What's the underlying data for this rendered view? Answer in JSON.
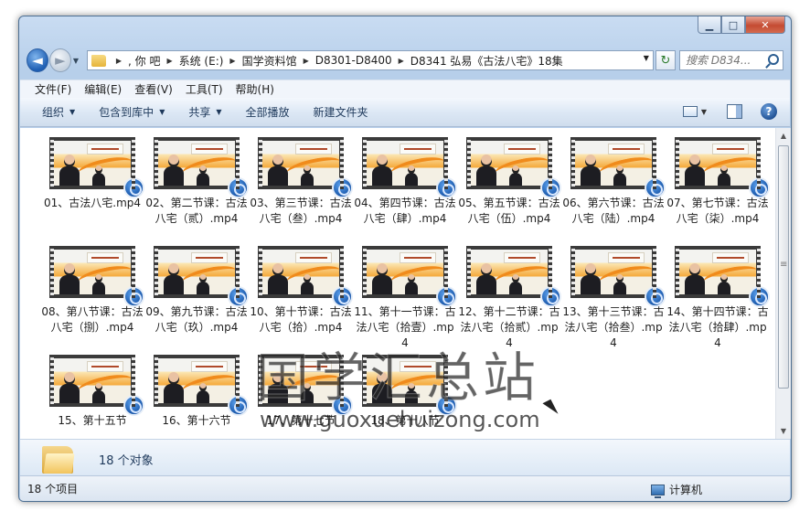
{
  "address_bar": {
    "crumbs": [
      ", 你    吧",
      "系统 (E:)",
      "国学资料馆",
      "D8301-D8400",
      "D8341 弘易《古法八宅》18集"
    ],
    "search_placeholder": "搜索 D834..."
  },
  "menu": [
    "文件(F)",
    "编辑(E)",
    "查看(V)",
    "工具(T)",
    "帮助(H)"
  ],
  "toolbar": {
    "organize": "组织",
    "include_library": "包含到库中",
    "share": "共享",
    "play_all": "全部播放",
    "new_folder": "新建文件夹"
  },
  "files": [
    "01、古法八宅.mp4",
    "02、第二节课：古法八宅（贰）.mp4",
    "03、第三节课：古法八宅（叁）.mp4",
    "04、第四节课：古法八宅（肆）.mp4",
    "05、第五节课：古法八宅（伍）.mp4",
    "06、第六节课：古法八宅（陆）.mp4",
    "07、第七节课：古法八宅（柒）.mp4",
    "08、第八节课：古法八宅（捌）.mp4",
    "09、第九节课：古法八宅（玖）.mp4",
    "10、第十节课：古法八宅（拾）.mp4",
    "11、第十一节课：古法八宅（拾壹）.mp4",
    "12、第十二节课：古法八宅（拾贰）.mp4",
    "13、第十三节课：古法八宅（拾叁）.mp4",
    "14、第十四节课：古法八宅（拾肆）.mp4",
    "15、第十五节",
    "16、第十六节",
    "17、第十七节",
    "18、第十八节"
  ],
  "watermark": {
    "text": "国学汇总站",
    "url": "www.guoxuehuizong.com"
  },
  "details": {
    "object_count": "18 个对象"
  },
  "status": {
    "items": "18 个项目",
    "location": "计算机"
  }
}
